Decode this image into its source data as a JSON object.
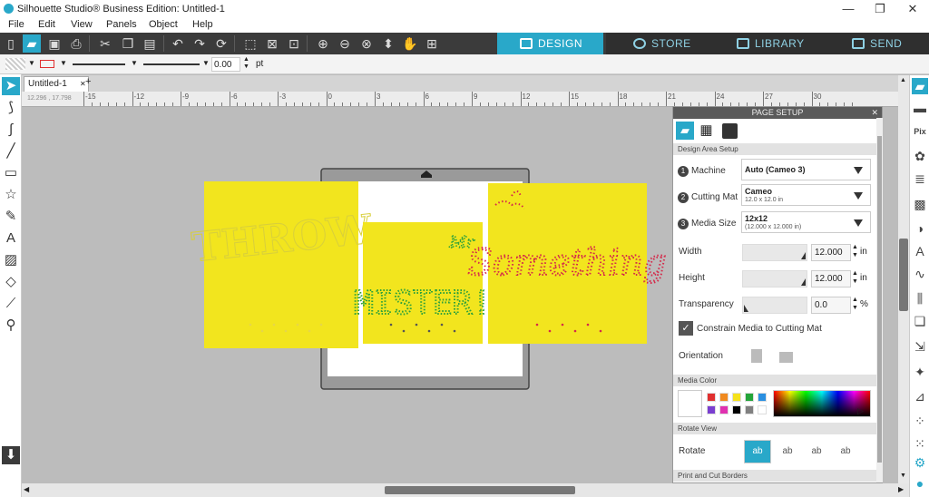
{
  "window": {
    "title": "Silhouette Studio® Business Edition: Untitled-1",
    "minimize": "—",
    "maximize": "❐",
    "close": "✕"
  },
  "menu": [
    "File",
    "Edit",
    "View",
    "Panels",
    "Object",
    "Help"
  ],
  "nav_tabs": {
    "design": "DESIGN",
    "store": "STORE",
    "library": "LIBRARY",
    "send": "SEND"
  },
  "line_style": {
    "width_value": "0.00",
    "unit": "pt"
  },
  "doc_tab": {
    "name": "Untitled-1",
    "close": "✕",
    "add": "+"
  },
  "coords": "12.296 , 17.798",
  "ruler_labels": [
    "-15",
    "-12",
    "-9",
    "-6",
    "-3",
    "0",
    "3",
    "6",
    "9",
    "12",
    "15",
    "18",
    "21",
    "24",
    "27",
    "30"
  ],
  "canvas": {
    "card1_text": "THROW",
    "card2_text": "MISTER!",
    "card2_script": "Mr",
    "card3_text": "Something",
    "colors": {
      "card": "#f2e51e",
      "green": "#2ea13a",
      "red": "#d42a4a"
    }
  },
  "panel": {
    "title": "PAGE SETUP",
    "close": "✕",
    "design_area_setup": "Design Area Setup",
    "machine": {
      "step": "1",
      "label": "Machine",
      "value": "Auto (Cameo 3)"
    },
    "cutting_mat": {
      "step": "2",
      "label": "Cutting Mat",
      "value": "Cameo",
      "sub": "12.0 x 12.0 in"
    },
    "media_size": {
      "step": "3",
      "label": "Media Size",
      "value": "12x12",
      "sub": "(12.000 x 12.000 in)"
    },
    "width": {
      "label": "Width",
      "value": "12.000",
      "unit": "in"
    },
    "height": {
      "label": "Height",
      "value": "12.000",
      "unit": "in"
    },
    "transparency": {
      "label": "Transparency",
      "value": "0.0",
      "unit": "%"
    },
    "constrain": {
      "label": "Constrain Media to Cutting Mat",
      "checked": true,
      "check": "✓"
    },
    "orientation": "Orientation",
    "media_color": "Media Color",
    "swatches": [
      "#e03030",
      "#f08a20",
      "#f5e21c",
      "#24a53a",
      "#2a8fe0",
      "#7a3fd0",
      "#e030b0",
      "#000000",
      "#808080",
      "#ffffff"
    ],
    "rotate_view": "Rotate View",
    "rotate": "Rotate",
    "rotate_buttons": [
      "ab",
      "ab",
      "ab",
      "ab"
    ],
    "print_cut_borders": "Print and Cut Borders"
  }
}
